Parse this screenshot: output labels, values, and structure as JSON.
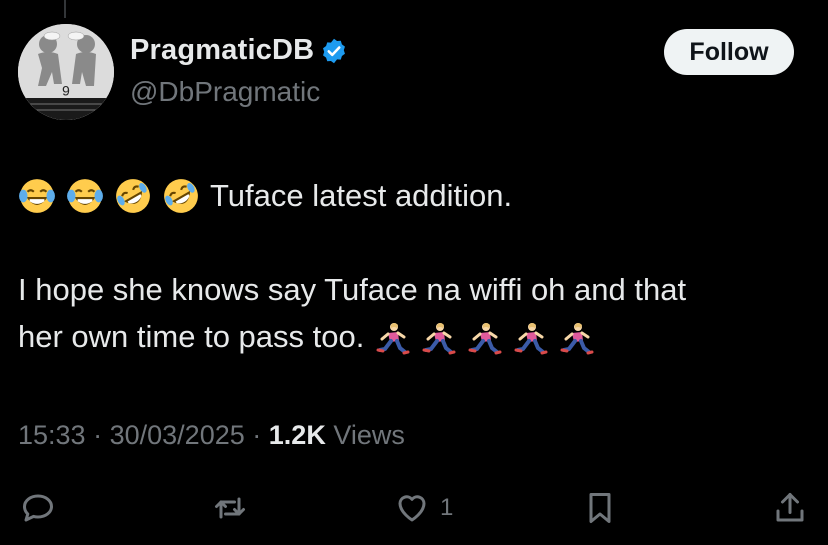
{
  "author": {
    "display_name": "PragmaticDB",
    "handle": "@DbPragmatic",
    "verified": true,
    "avatar_icon": "avatar-image"
  },
  "follow_button": {
    "label": "Follow"
  },
  "tweet": {
    "line1_emojis": [
      "face-with-tears-of-joy",
      "face-with-tears-of-joy",
      "rolling-on-the-floor-laughing",
      "rolling-on-the-floor-laughing"
    ],
    "line1_text": "Tuface latest addition.",
    "line2_text": "I hope she knows say Tuface na wiffi oh and that",
    "line3_text": "her own time to pass too.",
    "line3_emojis": [
      "woman-running",
      "woman-running",
      "woman-running",
      "woman-running",
      "woman-running"
    ]
  },
  "meta": {
    "time": "15:33",
    "separator": "·",
    "date": "30/03/2025",
    "views_count": "1.2K",
    "views_label": "Views"
  },
  "actions": {
    "reply_icon": "reply-icon",
    "retweet_icon": "retweet-icon",
    "like_icon": "heart-icon",
    "like_count": "1",
    "bookmark_icon": "bookmark-icon",
    "share_icon": "share-icon"
  },
  "colors": {
    "background": "#000000",
    "primary_text": "#e7e9ea",
    "secondary_text": "#71767b",
    "verified_blue": "#1d9bf0",
    "follow_bg": "#eff3f4"
  }
}
